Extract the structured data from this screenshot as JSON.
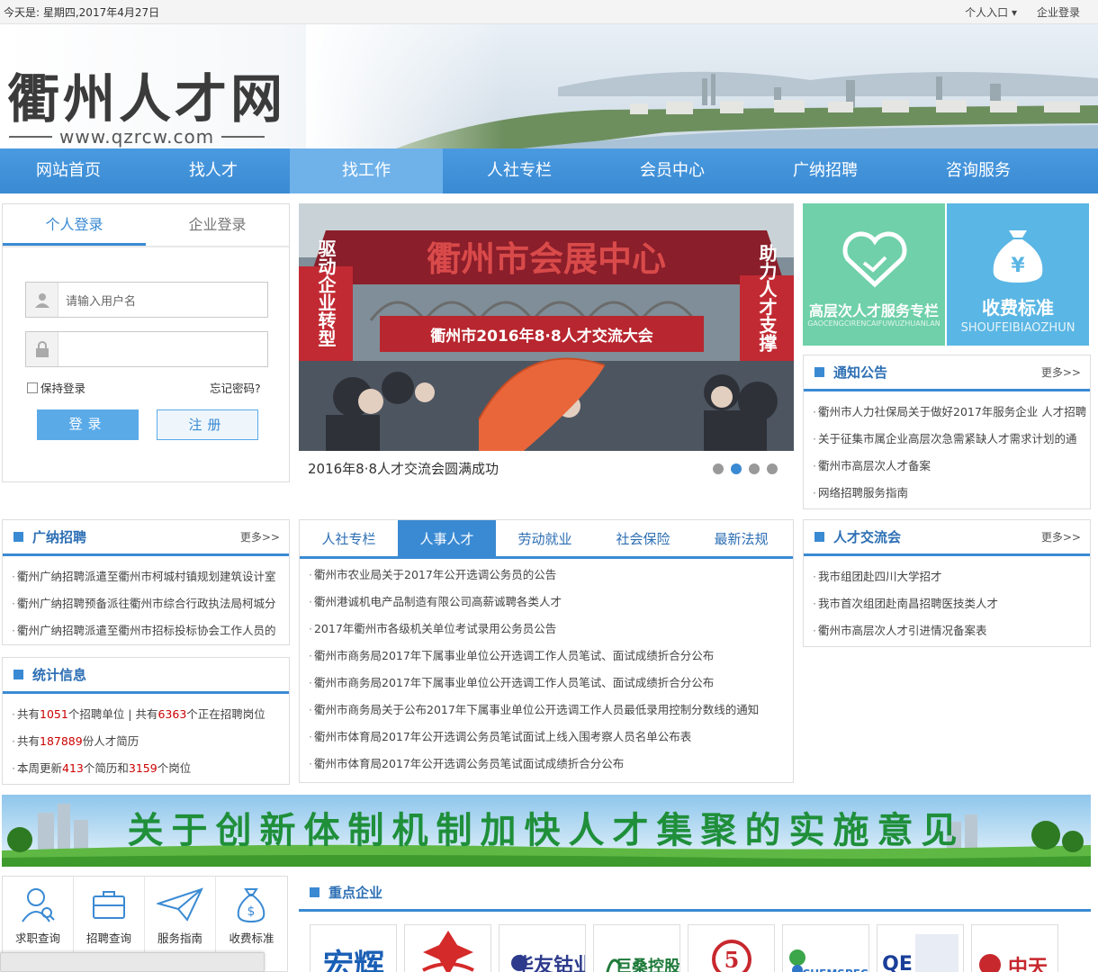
{
  "topbar": {
    "date": "今天是: 星期四,2017年4月27日",
    "personal": "个人入口",
    "company": "企业登录"
  },
  "header": {
    "logo": "衢州人才网",
    "url": "www.qzrcw.com"
  },
  "nav": [
    "网站首页",
    "找人才",
    "找工作",
    "人社专栏",
    "会员中心",
    "广纳招聘",
    "咨询服务"
  ],
  "login": {
    "tabs": [
      "个人登录",
      "企业登录"
    ],
    "username_placeholder": "请输入用户名",
    "remember": "保持登录",
    "forgot": "忘记密码?",
    "login_btn": "登录",
    "register_btn": "注册"
  },
  "slider": {
    "banner_text": "衢州市会展中心",
    "hall_text": "衢州市2016年8·8人才交流大会",
    "left_banner": "驱动企业转型",
    "right_banner": "助力人才支撑",
    "caption": "2016年8·8人才交流会圆满成功",
    "active_dot": 1
  },
  "tiles": [
    {
      "title": "高层次人才服务专栏",
      "sub": "GAOCENGCIRENCAIFUWUZHUANLAN",
      "color": "#6fd0a9"
    },
    {
      "title": "收费标准",
      "sub": "SHOUFEIBIAOZHUN",
      "color": "#5ab6e4"
    }
  ],
  "notice": {
    "title": "通知公告",
    "more": "更多>>",
    "items": [
      "衢州市人力社保局关于做好2017年服务企业 人才招聘",
      "关于征集市属企业高层次急需紧缺人才需求计划的通",
      "衢州市高层次人才备案",
      "网络招聘服务指南"
    ]
  },
  "recruit": {
    "title": "广纳招聘",
    "more": "更多>>",
    "items": [
      "衢州广纳招聘派遣至衢州市柯城村镇规划建筑设计室",
      "衢州广纳招聘预备派往衢州市综合行政执法局柯城分",
      "衢州广纳招聘派遣至衢州市招标投标协会工作人员的"
    ]
  },
  "stats": {
    "title": "统计信息",
    "l1a": "共有",
    "units": "1051",
    "l1b": "个招聘单位 | 共有",
    "posts": "6363",
    "l1c": "个正在招聘岗位",
    "l2a": "共有",
    "resumes": "187889",
    "l2b": "份人才简历",
    "l3a": "本周更新",
    "week_resumes": "413",
    "l3b": "个简历和",
    "week_posts": "3159",
    "l3c": "个岗位"
  },
  "news": {
    "tabs": [
      "人社专栏",
      "人事人才",
      "劳动就业",
      "社会保险",
      "最新法规"
    ],
    "items": [
      "衢州市农业局关于2017年公开选调公务员的公告",
      "衢州港诚机电产品制造有限公司高薪诚聘各类人才",
      "2017年衢州市各级机关单位考试录用公务员公告",
      "衢州市商务局2017年下属事业单位公开选调工作人员笔试、面试成绩折合分公布",
      "衢州市商务局2017年下属事业单位公开选调工作人员笔试、面试成绩折合分公布",
      "衢州市商务局关于公布2017年下属事业单位公开选调工作人员最低录用控制分数线的通知",
      "衢州市体育局2017年公开选调公务员笔试面试上线入围考察人员名单公布表",
      "衢州市体育局2017年公开选调公务员笔试面试成绩折合分公布"
    ]
  },
  "fair": {
    "title": "人才交流会",
    "more": "更多>>",
    "items": [
      "我市组团赴四川大学招才",
      "我市首次组团赴南昌招聘医技类人才",
      "衢州市高层次人才引进情况备案表"
    ]
  },
  "wide_banner": "关于创新体制机制加快人才集聚的实施意见",
  "quick": [
    "求职查询",
    "招聘查询",
    "服务指南",
    "收费标准"
  ],
  "companies_title": "重点企业"
}
